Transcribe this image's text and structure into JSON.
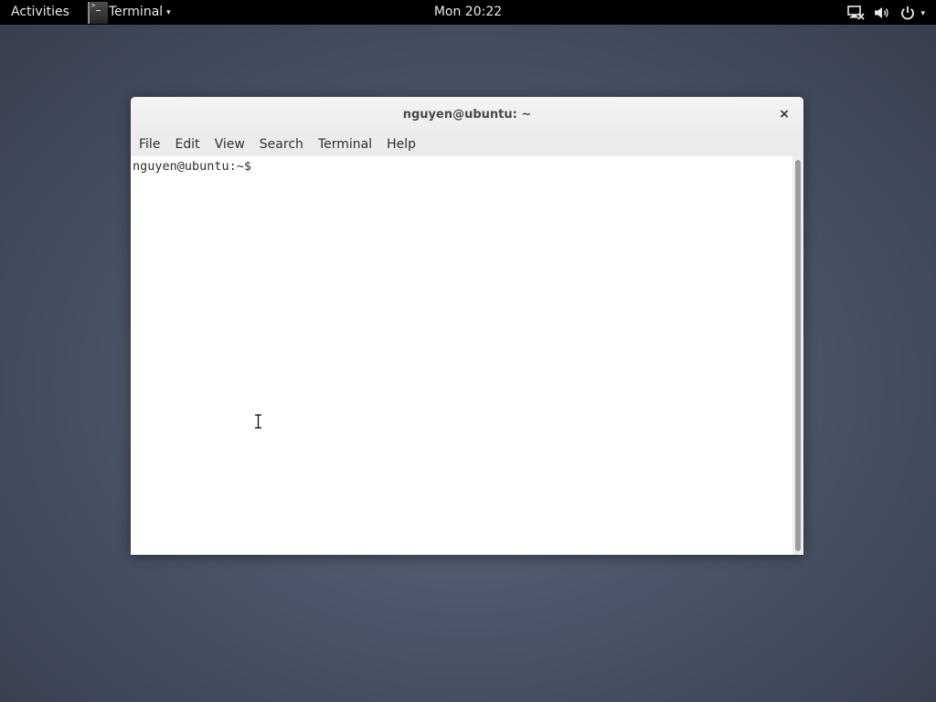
{
  "topbar": {
    "activities_label": "Activities",
    "app_name": "Terminal",
    "app_menu_arrow": "▾",
    "app_icon": "terminal-app-icon",
    "clock": "Mon 20:22",
    "tray_icons": [
      "network-icon",
      "volume-icon",
      "power-icon"
    ],
    "tray_arrow": "▾"
  },
  "window": {
    "title": "nguyen@ubuntu: ~",
    "close_glyph": "×",
    "menu": [
      "File",
      "Edit",
      "View",
      "Search",
      "Terminal",
      "Help"
    ]
  },
  "terminal": {
    "prompt": "nguyen@ubuntu:~$"
  },
  "colors": {
    "topbar_bg": "#000000",
    "desktop_center": "#5e6a80",
    "desktop_edge": "#353c4b",
    "window_chrome": "#ececec",
    "terminal_bg": "#ffffff",
    "terminal_fg": "#2e2e2e"
  }
}
